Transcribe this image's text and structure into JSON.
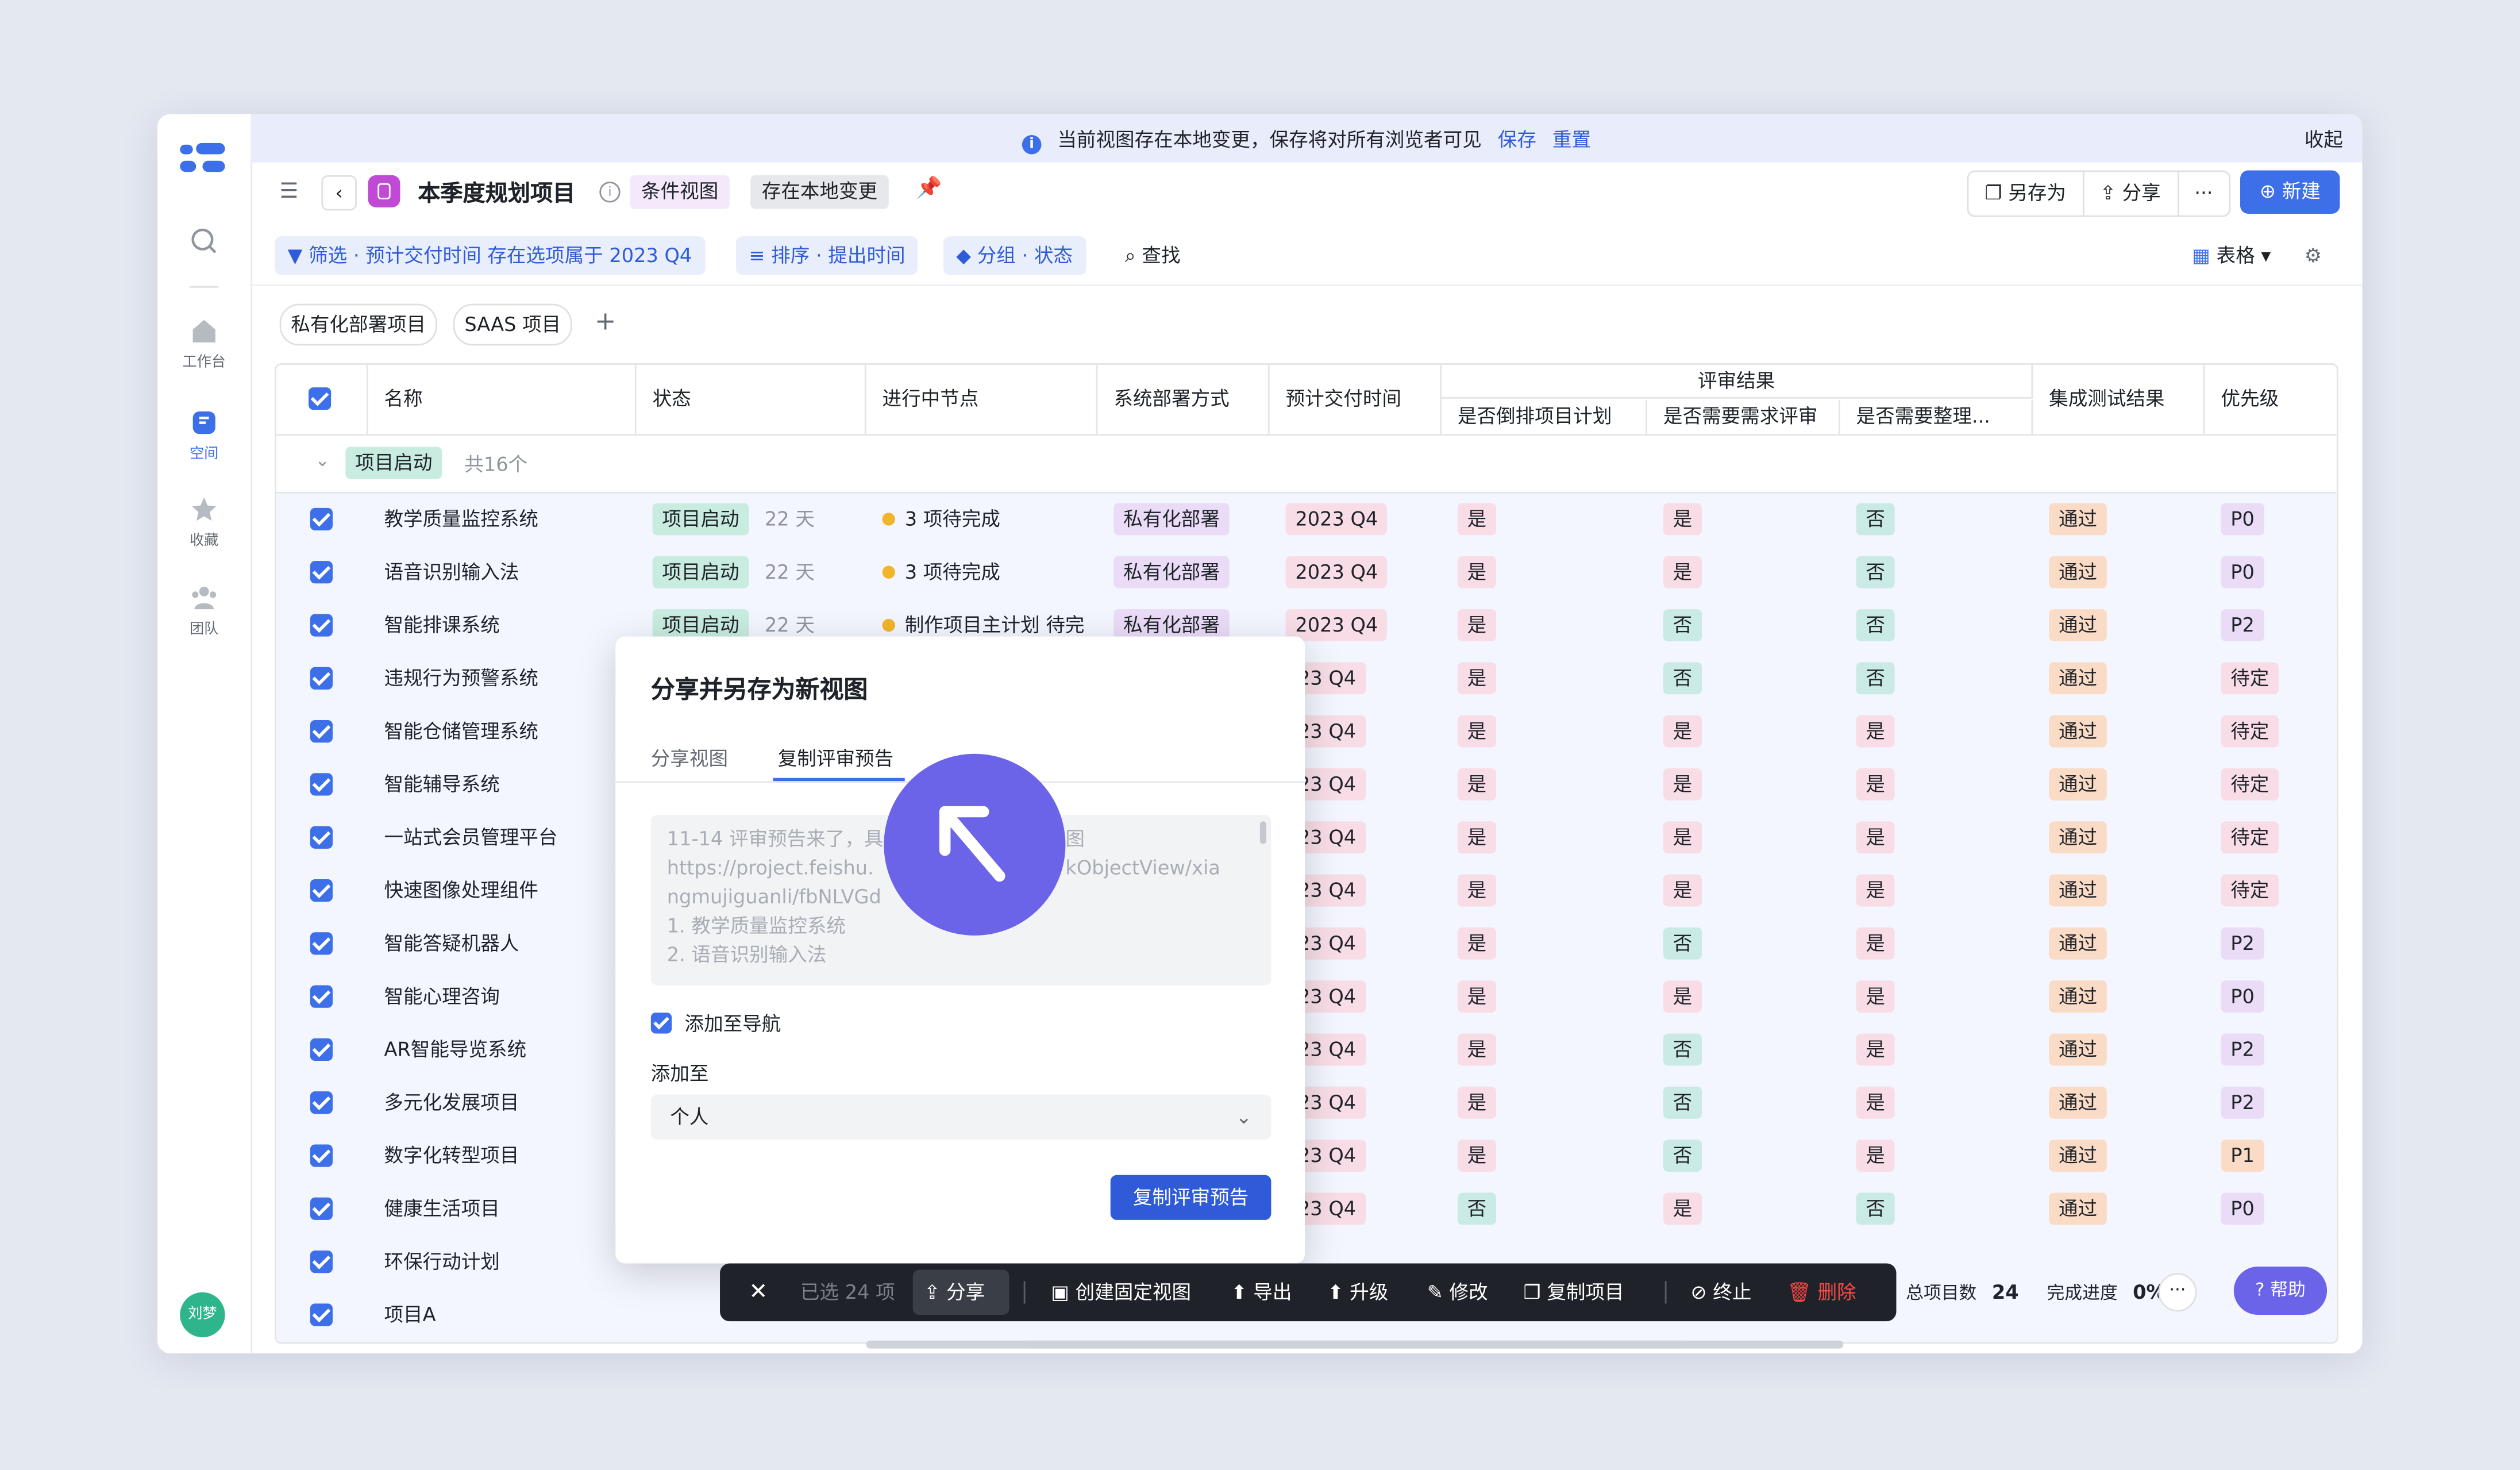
{
  "banner": {
    "message": "当前视图存在本地变更，保存将对所有浏览者可见",
    "save": "保存",
    "reset": "重置",
    "collapse": "收起"
  },
  "rail": {
    "items": [
      {
        "label": "工作台"
      },
      {
        "label": "空间"
      },
      {
        "label": "收藏"
      },
      {
        "label": "团队"
      }
    ],
    "avatar": "刘梦",
    "accent": "#3c6fe8"
  },
  "header": {
    "title": "本季度规划项目",
    "cond_view": "条件视图",
    "local_changes": "存在本地变更",
    "save_as": "另存为",
    "share": "分享",
    "more": "···",
    "new": "新建"
  },
  "toolbar": {
    "filter": "筛选 · 预计交付时间 存在选项属于 2023 Q4",
    "sort": "排序 · 提出时间",
    "group": "分组 · 状态",
    "find": "查找",
    "view_type": "表格"
  },
  "view_tabs": [
    "私有化部署项目",
    "SAAS 项目",
    "+"
  ],
  "table": {
    "columns": {
      "name": "名称",
      "status": "状态",
      "node": "进行中节点",
      "deploy": "系统部署方式",
      "delivery": "预计交付时间",
      "review_group": "评审结果",
      "review1": "是否倒排项目计划",
      "review2": "是否需要需求评审",
      "review3": "是否需要整理...",
      "test": "集成测试结果",
      "priority": "优先级"
    },
    "group": {
      "label": "项目启动",
      "count": "共16个"
    },
    "rows": [
      {
        "name": "教学质量监控系统",
        "status": "项目启动",
        "days": "22 天",
        "node": "3 项待完成",
        "deploy": "私有化部署",
        "delivery": "2023 Q4",
        "r1": "是",
        "r2": "是",
        "r3": "否",
        "test": "通过",
        "priority": "P0"
      },
      {
        "name": "语音识别输入法",
        "status": "项目启动",
        "days": "22 天",
        "node": "3 项待完成",
        "deploy": "私有化部署",
        "delivery": "2023 Q4",
        "r1": "是",
        "r2": "是",
        "r3": "否",
        "test": "通过",
        "priority": "P0"
      },
      {
        "name": "智能排课系统",
        "status": "项目启动",
        "days": "22 天",
        "node": "制作项目主计划 待完",
        "deploy": "私有化部署",
        "delivery": "2023 Q4",
        "r1": "是",
        "r2": "否",
        "r3": "否",
        "test": "通过",
        "priority": "P2"
      },
      {
        "name": "违规行为预警系统",
        "status": "",
        "days": "",
        "node": "",
        "deploy": "",
        "delivery": "023 Q4",
        "r1": "是",
        "r2": "否",
        "r3": "否",
        "test": "通过",
        "priority": "待定"
      },
      {
        "name": "智能仓储管理系统",
        "status": "",
        "days": "",
        "node": "",
        "deploy": "",
        "delivery": "023 Q4",
        "r1": "是",
        "r2": "是",
        "r3": "是",
        "test": "通过",
        "priority": "待定"
      },
      {
        "name": "智能辅导系统",
        "status": "",
        "days": "",
        "node": "",
        "deploy": "",
        "delivery": "023 Q4",
        "r1": "是",
        "r2": "是",
        "r3": "是",
        "test": "通过",
        "priority": "待定"
      },
      {
        "name": "一站式会员管理平台",
        "status": "",
        "days": "",
        "node": "",
        "deploy": "",
        "delivery": "023 Q4",
        "r1": "是",
        "r2": "是",
        "r3": "是",
        "test": "通过",
        "priority": "待定"
      },
      {
        "name": "快速图像处理组件",
        "status": "",
        "days": "",
        "node": "",
        "deploy": "",
        "delivery": "023 Q4",
        "r1": "是",
        "r2": "是",
        "r3": "是",
        "test": "通过",
        "priority": "待定"
      },
      {
        "name": "智能答疑机器人",
        "status": "",
        "days": "",
        "node": "",
        "deploy": "",
        "delivery": "023 Q4",
        "r1": "是",
        "r2": "否",
        "r3": "是",
        "test": "通过",
        "priority": "P2"
      },
      {
        "name": "智能心理咨询",
        "status": "",
        "days": "",
        "node": "",
        "deploy": "",
        "delivery": "023 Q4",
        "r1": "是",
        "r2": "是",
        "r3": "是",
        "test": "通过",
        "priority": "P0"
      },
      {
        "name": "AR智能导览系统",
        "status": "",
        "days": "",
        "node": "",
        "deploy": "",
        "delivery": "023 Q4",
        "r1": "是",
        "r2": "否",
        "r3": "是",
        "test": "通过",
        "priority": "P2"
      },
      {
        "name": "多元化发展项目",
        "status": "",
        "days": "",
        "node": "",
        "deploy": "",
        "delivery": "023 Q4",
        "r1": "是",
        "r2": "否",
        "r3": "是",
        "test": "通过",
        "priority": "P2"
      },
      {
        "name": "数字化转型项目",
        "status": "",
        "days": "",
        "node": "",
        "deploy": "",
        "delivery": "023 Q4",
        "r1": "是",
        "r2": "否",
        "r3": "是",
        "test": "通过",
        "priority": "P1"
      },
      {
        "name": "健康生活项目",
        "status": "",
        "days": "",
        "node": "",
        "deploy": "",
        "delivery": "023 Q4",
        "r1": "否",
        "r2": "是",
        "r3": "否",
        "test": "通过",
        "priority": "P0"
      },
      {
        "name": "环保行动计划",
        "status": "",
        "days": "",
        "node": "",
        "deploy": "",
        "delivery": "",
        "r1": "",
        "r2": "",
        "r3": "",
        "test": "",
        "priority": ""
      },
      {
        "name": "项目A",
        "status": "",
        "days": "",
        "node": "",
        "deploy": "",
        "delivery": "",
        "r1": "",
        "r2": "",
        "r3": "",
        "test": "",
        "priority": ""
      }
    ]
  },
  "dialog": {
    "title": "分享并另存为新视图",
    "tab_share": "分享视图",
    "tab_copy": "复制评审预告",
    "text_lines": [
      "11-14 评审预告来了，具",
      "https://project.feishu.",
      "ngmujiguanli/fbNLVGd",
      "1. 教学质量监控系统",
      "2. 语音识别输入法"
    ],
    "text_right_1": "图",
    "text_right_2": "kObjectView/xia",
    "add_nav": "添加至导航",
    "add_to": "添加至",
    "select_value": "个人",
    "copy_button": "复制评审预告"
  },
  "actionbar": {
    "selected": "已选 24 项",
    "share": "分享",
    "create_fixed": "创建固定视图",
    "export": "导出",
    "upgrade": "升级",
    "edit": "修改",
    "copy_project": "复制项目",
    "terminate": "终止",
    "delete": "删除"
  },
  "summary": {
    "total_label": "总项目数",
    "total": "24",
    "progress_label": "完成进度",
    "progress": "0%"
  },
  "help": "帮助"
}
